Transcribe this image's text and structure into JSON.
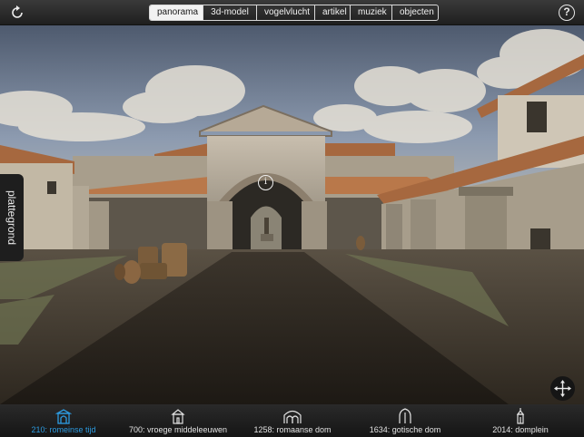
{
  "toolbar": {
    "refresh_icon": "refresh-icon",
    "help_label": "?",
    "tabs": [
      {
        "label": "panorama",
        "active": true
      },
      {
        "label": "3d-model",
        "active": false
      },
      {
        "label": "vogelvlucht",
        "active": false
      },
      {
        "label": "artikel",
        "active": false
      },
      {
        "label": "muziek",
        "active": false
      },
      {
        "label": "objecten",
        "active": false
      }
    ]
  },
  "side_tab": {
    "label": "plattegrond"
  },
  "hotspot": {
    "label": "i"
  },
  "move_control": {
    "icon": "move-arrows-icon"
  },
  "timeline": {
    "active_color": "#2d9be0",
    "periods": [
      {
        "label": "210: romeinse tijd",
        "icon": "roman-gate-icon",
        "active": true
      },
      {
        "label": "700: vroege middeleeuwen",
        "icon": "early-church-icon",
        "active": false
      },
      {
        "label": "1258: romaanse dom",
        "icon": "romanesque-arches-icon",
        "active": false
      },
      {
        "label": "1634: gotische dom",
        "icon": "gothic-arch-icon",
        "active": false
      },
      {
        "label": "2014: domplein",
        "icon": "dom-tower-icon",
        "active": false
      }
    ]
  }
}
